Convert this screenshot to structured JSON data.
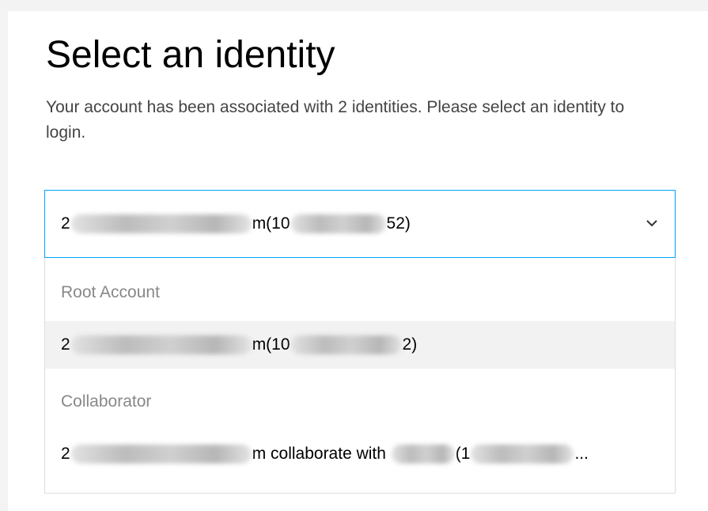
{
  "page": {
    "title": "Select an identity",
    "description": "Your account has been associated with 2 identities. Please select an identity to login."
  },
  "select": {
    "value_parts": [
      "2",
      "m(10",
      "52)"
    ]
  },
  "dropdown": {
    "groups": [
      {
        "label": "Root Account",
        "options": [
          {
            "parts": [
              "2",
              "m(10",
              "2)"
            ]
          }
        ]
      },
      {
        "label": "Collaborator",
        "options": [
          {
            "parts": [
              "2",
              "m collaborate with ",
              "(1",
              "..."
            ]
          }
        ]
      }
    ]
  },
  "colors": {
    "accent": "#00a4ff",
    "hover_bg": "#f2f2f2",
    "group_label": "#888888"
  },
  "icons": {
    "dropdown": "chevron-down-icon"
  }
}
